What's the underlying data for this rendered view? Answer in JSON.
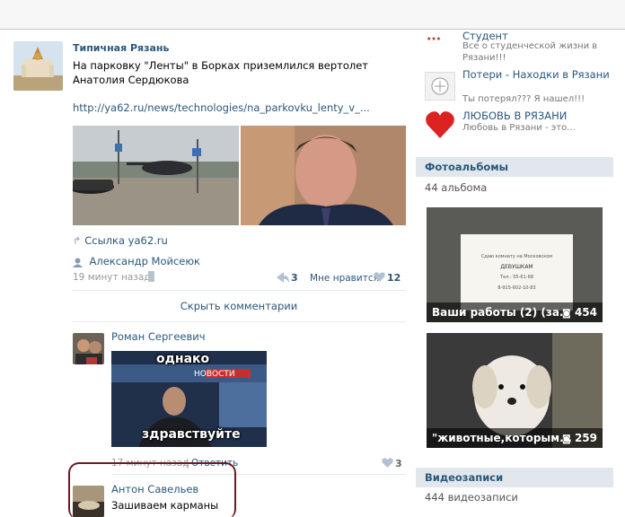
{
  "post": {
    "author": "Типичная Рязань",
    "text": "На парковку \"Ленты\" в Борках приземлился вертолет Анатолия Сердюкова",
    "link": "http://ya62.ru/news/technologies/na_parkovku_lenty_v_...",
    "source_link": "Ссылка ya62.ru",
    "signer": "Александр Мойсеюк",
    "time": "19 минут назад",
    "reposts": "3",
    "like_label": "Мне нравится",
    "likes": "12",
    "hide_comments": "Скрыть комментарии",
    "photo_overlay": {
      "news_band": "НОВОСТИ"
    }
  },
  "comments": [
    {
      "author": "Роман Сергеевич",
      "video_top": "однако",
      "video_bottom": "здравствуйте",
      "time": "17 минут назад",
      "reply": "Ответить",
      "likes": "3"
    },
    {
      "author": "Антон Савельев",
      "text": "Зашиваем карманы"
    }
  ],
  "sidebar": {
    "groups": [
      {
        "name": "Студент",
        "sub": "Все о студенческой жизни в Рязани!!!"
      },
      {
        "name": "Потери - Находки в Рязани",
        "sub": "Ты потерял??? Я нашел!!!"
      },
      {
        "name": "ЛЮБОВЬ В РЯЗАНИ",
        "sub": "Любовь в Рязани - это..."
      }
    ],
    "photos_header": "Фотоальбомы",
    "photos_count": "44 альбома",
    "albums": [
      {
        "title": "Ваши работы (2) (за..",
        "count": "454",
        "note_lines": [
          "Сдаю комнату на Московском",
          "ДЕВУШКАМ",
          "Тел.: 55-61-68",
          "8-915-602-10-83"
        ]
      },
      {
        "title": "\"животные,которым...",
        "count": "259"
      }
    ],
    "videos_header": "Видеозаписи",
    "videos_count": "444 видеозаписи"
  },
  "colors": {
    "link": "#2b587a",
    "sidebar_header_bg": "#e1e7ed",
    "highlight_circle": "#6d1a22"
  }
}
